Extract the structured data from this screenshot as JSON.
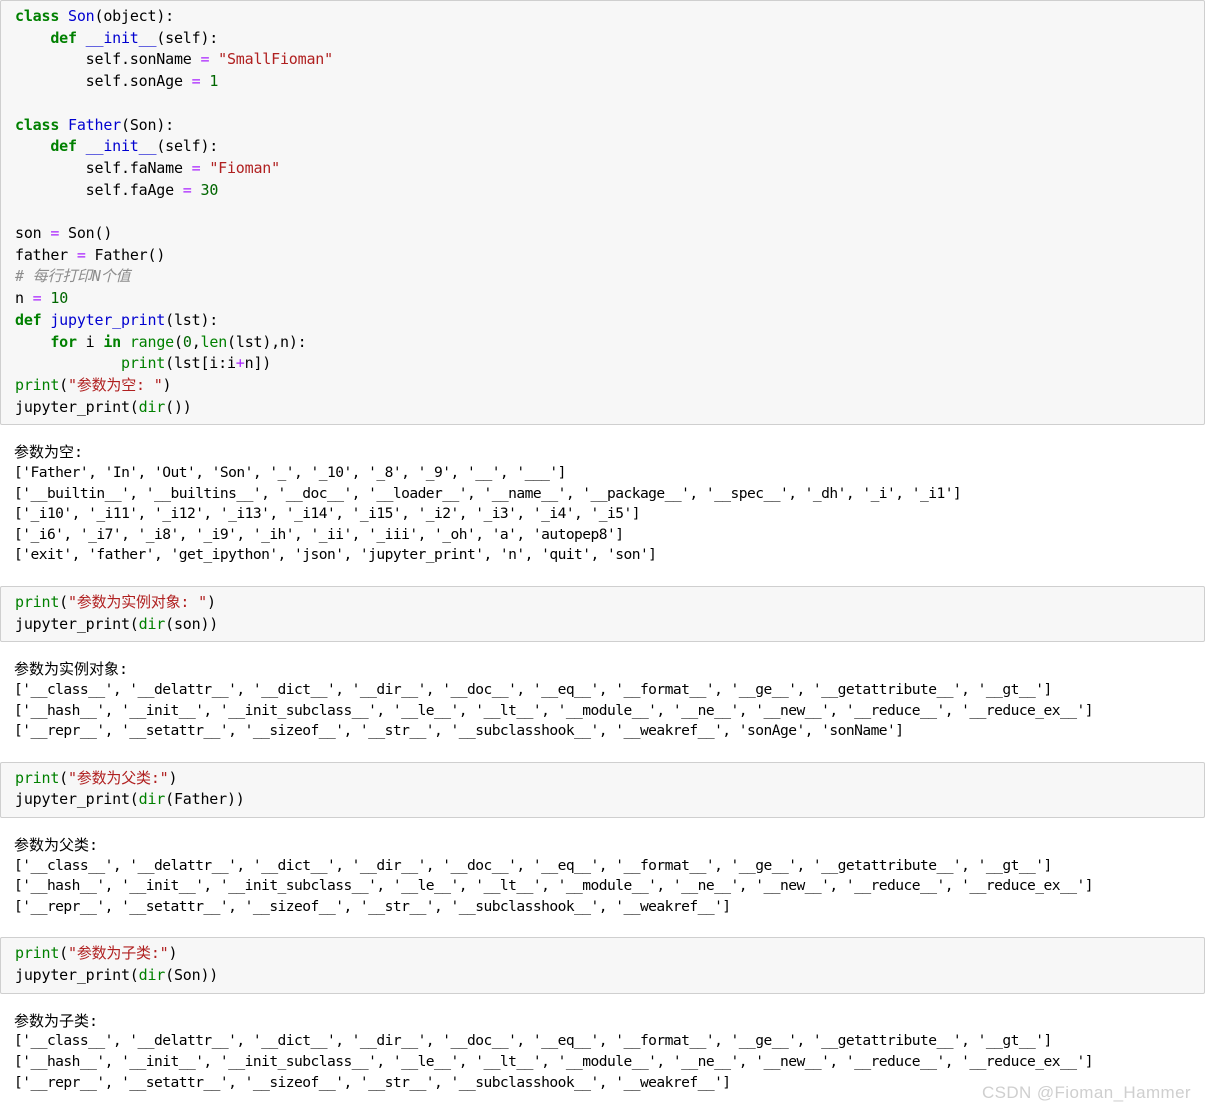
{
  "watermark": "CSDN @Fioman_Hammer",
  "cells": [
    {
      "type": "code",
      "name": "code-cell-class-definitions",
      "lines": [
        [
          {
            "t": "class ",
            "c": "kw"
          },
          {
            "t": "Son",
            "c": "cls"
          },
          {
            "t": "(object):",
            "c": "plain"
          }
        ],
        [
          {
            "t": "    ",
            "c": "plain"
          },
          {
            "t": "def ",
            "c": "kw"
          },
          {
            "t": "__init__",
            "c": "fn"
          },
          {
            "t": "(self):",
            "c": "plain"
          }
        ],
        [
          {
            "t": "        self.sonName ",
            "c": "plain"
          },
          {
            "t": "=",
            "c": "op"
          },
          {
            "t": " ",
            "c": "plain"
          },
          {
            "t": "\"SmallFioman\"",
            "c": "str"
          }
        ],
        [
          {
            "t": "        self.sonAge ",
            "c": "plain"
          },
          {
            "t": "=",
            "c": "op"
          },
          {
            "t": " ",
            "c": "plain"
          },
          {
            "t": "1",
            "c": "num"
          }
        ],
        [
          {
            "t": "",
            "c": "plain"
          }
        ],
        [
          {
            "t": "class ",
            "c": "kw"
          },
          {
            "t": "Father",
            "c": "cls"
          },
          {
            "t": "(Son):",
            "c": "plain"
          }
        ],
        [
          {
            "t": "    ",
            "c": "plain"
          },
          {
            "t": "def ",
            "c": "kw"
          },
          {
            "t": "__init__",
            "c": "fn"
          },
          {
            "t": "(self):",
            "c": "plain"
          }
        ],
        [
          {
            "t": "        self.faName ",
            "c": "plain"
          },
          {
            "t": "=",
            "c": "op"
          },
          {
            "t": " ",
            "c": "plain"
          },
          {
            "t": "\"Fioman\"",
            "c": "str"
          }
        ],
        [
          {
            "t": "        self.faAge ",
            "c": "plain"
          },
          {
            "t": "=",
            "c": "op"
          },
          {
            "t": " ",
            "c": "plain"
          },
          {
            "t": "30",
            "c": "num"
          }
        ],
        [
          {
            "t": "",
            "c": "plain"
          }
        ],
        [
          {
            "t": "son ",
            "c": "plain"
          },
          {
            "t": "=",
            "c": "op"
          },
          {
            "t": " Son()",
            "c": "plain"
          }
        ],
        [
          {
            "t": "father ",
            "c": "plain"
          },
          {
            "t": "=",
            "c": "op"
          },
          {
            "t": " Father()",
            "c": "plain"
          }
        ],
        [
          {
            "t": "# 每行打印N个值",
            "c": "cmt"
          }
        ],
        [
          {
            "t": "n ",
            "c": "plain"
          },
          {
            "t": "=",
            "c": "op"
          },
          {
            "t": " ",
            "c": "plain"
          },
          {
            "t": "10",
            "c": "num"
          }
        ],
        [
          {
            "t": "def ",
            "c": "kw"
          },
          {
            "t": "jupyter_print",
            "c": "fn"
          },
          {
            "t": "(lst):",
            "c": "plain"
          }
        ],
        [
          {
            "t": "    ",
            "c": "plain"
          },
          {
            "t": "for",
            "c": "kw"
          },
          {
            "t": " i ",
            "c": "plain"
          },
          {
            "t": "in",
            "c": "kw"
          },
          {
            "t": " ",
            "c": "plain"
          },
          {
            "t": "range",
            "c": "bfn"
          },
          {
            "t": "(",
            "c": "plain"
          },
          {
            "t": "0",
            "c": "num"
          },
          {
            "t": ",",
            "c": "plain"
          },
          {
            "t": "len",
            "c": "bfn"
          },
          {
            "t": "(lst),n):",
            "c": "plain"
          }
        ],
        [
          {
            "t": "            ",
            "c": "plain"
          },
          {
            "t": "print",
            "c": "bfn"
          },
          {
            "t": "(lst[i:i",
            "c": "plain"
          },
          {
            "t": "+",
            "c": "op"
          },
          {
            "t": "n])",
            "c": "plain"
          }
        ],
        [
          {
            "t": "print",
            "c": "bfn"
          },
          {
            "t": "(",
            "c": "plain"
          },
          {
            "t": "\"参数为空: \"",
            "c": "str"
          },
          {
            "t": ")",
            "c": "plain"
          }
        ],
        [
          {
            "t": "jupyter_print(",
            "c": "plain"
          },
          {
            "t": "dir",
            "c": "bfn"
          },
          {
            "t": "())",
            "c": "plain"
          }
        ]
      ]
    },
    {
      "type": "output",
      "name": "output-cell-empty-arg",
      "heading": "参数为空:",
      "lines": [
        "['Father', 'In', 'Out', 'Son', '_', '_10', '_8', '_9', '__', '___']",
        "['__builtin__', '__builtins__', '__doc__', '__loader__', '__name__', '__package__', '__spec__', '_dh', '_i', '_i1']",
        "['_i10', '_i11', '_i12', '_i13', '_i14', '_i15', '_i2', '_i3', '_i4', '_i5']",
        "['_i6', '_i7', '_i8', '_i9', '_ih', '_ii', '_iii', '_oh', 'a', 'autopep8']",
        "['exit', 'father', 'get_ipython', 'json', 'jupyter_print', 'n', 'quit', 'son']"
      ]
    },
    {
      "type": "code",
      "name": "code-cell-dir-instance",
      "lines": [
        [
          {
            "t": "print",
            "c": "bfn"
          },
          {
            "t": "(",
            "c": "plain"
          },
          {
            "t": "\"参数为实例对象: \"",
            "c": "str"
          },
          {
            "t": ")",
            "c": "plain"
          }
        ],
        [
          {
            "t": "jupyter_print(",
            "c": "plain"
          },
          {
            "t": "dir",
            "c": "bfn"
          },
          {
            "t": "(son))",
            "c": "plain"
          }
        ]
      ]
    },
    {
      "type": "output",
      "name": "output-cell-instance-arg",
      "heading": "参数为实例对象:",
      "lines": [
        "['__class__', '__delattr__', '__dict__', '__dir__', '__doc__', '__eq__', '__format__', '__ge__', '__getattribute__', '__gt__']",
        "['__hash__', '__init__', '__init_subclass__', '__le__', '__lt__', '__module__', '__ne__', '__new__', '__reduce__', '__reduce_ex__']",
        "['__repr__', '__setattr__', '__sizeof__', '__str__', '__subclasshook__', '__weakref__', 'sonAge', 'sonName']"
      ]
    },
    {
      "type": "code",
      "name": "code-cell-dir-father",
      "lines": [
        [
          {
            "t": "print",
            "c": "bfn"
          },
          {
            "t": "(",
            "c": "plain"
          },
          {
            "t": "\"参数为父类:\"",
            "c": "str"
          },
          {
            "t": ")",
            "c": "plain"
          }
        ],
        [
          {
            "t": "jupyter_print(",
            "c": "plain"
          },
          {
            "t": "dir",
            "c": "bfn"
          },
          {
            "t": "(Father))",
            "c": "plain"
          }
        ]
      ]
    },
    {
      "type": "output",
      "name": "output-cell-father-arg",
      "heading": "参数为父类:",
      "lines": [
        "['__class__', '__delattr__', '__dict__', '__dir__', '__doc__', '__eq__', '__format__', '__ge__', '__getattribute__', '__gt__']",
        "['__hash__', '__init__', '__init_subclass__', '__le__', '__lt__', '__module__', '__ne__', '__new__', '__reduce__', '__reduce_ex__']",
        "['__repr__', '__setattr__', '__sizeof__', '__str__', '__subclasshook__', '__weakref__']"
      ]
    },
    {
      "type": "code",
      "name": "code-cell-dir-son",
      "lines": [
        [
          {
            "t": "print",
            "c": "bfn"
          },
          {
            "t": "(",
            "c": "plain"
          },
          {
            "t": "\"参数为子类:\"",
            "c": "str"
          },
          {
            "t": ")",
            "c": "plain"
          }
        ],
        [
          {
            "t": "jupyter_print(",
            "c": "plain"
          },
          {
            "t": "dir",
            "c": "bfn"
          },
          {
            "t": "(Son))",
            "c": "plain"
          }
        ]
      ]
    },
    {
      "type": "output",
      "name": "output-cell-son-arg",
      "heading": "参数为子类:",
      "lines": [
        "['__class__', '__delattr__', '__dict__', '__dir__', '__doc__', '__eq__', '__format__', '__ge__', '__getattribute__', '__gt__']",
        "['__hash__', '__init__', '__init_subclass__', '__le__', '__lt__', '__module__', '__ne__', '__new__', '__reduce__', '__reduce_ex__']",
        "['__repr__', '__setattr__', '__sizeof__', '__str__', '__subclasshook__', '__weakref__']"
      ]
    }
  ]
}
